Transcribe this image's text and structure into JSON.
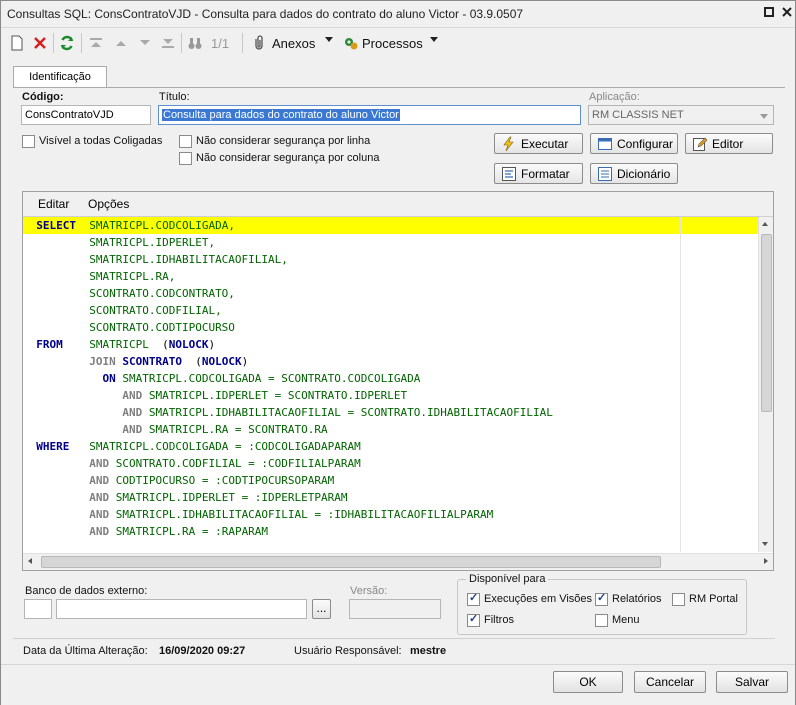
{
  "window": {
    "title": "Consultas SQL: ConsContratoVJD - Consulta para dados do contrato do aluno Victor - 03.9.0507"
  },
  "toolbar": {
    "page_indicator": "1/1",
    "anexos_label": "Anexos",
    "processos_label": "Processos"
  },
  "tabs": [
    {
      "label": "Identificação"
    }
  ],
  "form": {
    "codigo_label": "Código:",
    "codigo_value": "ConsContratoVJD",
    "titulo_label": "Título:",
    "titulo_value": "Consulta para dados do contrato do aluno Victor",
    "aplicacao_label": "Aplicação:",
    "aplicacao_value": "RM CLASSIS NET",
    "visivel_label": "Visível a todas Coligadas",
    "seg_linha_label": "Não considerar segurança por linha",
    "seg_coluna_label": "Não considerar segurança por coluna"
  },
  "buttons": {
    "executar": "Executar",
    "configurar": "Configurar",
    "editor": "Editor",
    "formatar": "Formatar",
    "dicionario": "Dicionário"
  },
  "editor_menu": {
    "editar": "Editar",
    "opcoes": "Opções"
  },
  "sql_lines": [
    [
      [
        "kw",
        "SELECT"
      ],
      [
        "t",
        "  "
      ],
      [
        "id",
        "SMATRICPL.CODCOLIGADA,"
      ]
    ],
    [
      [
        "t",
        "        "
      ],
      [
        "id",
        "SMATRICPL.IDPERLET,"
      ]
    ],
    [
      [
        "t",
        "        "
      ],
      [
        "id",
        "SMATRICPL.IDHABILITACAOFILIAL,"
      ]
    ],
    [
      [
        "t",
        "        "
      ],
      [
        "id",
        "SMATRICPL.RA,"
      ]
    ],
    [
      [
        "t",
        "        "
      ],
      [
        "id",
        "SCONTRATO.CODCONTRATO,"
      ]
    ],
    [
      [
        "t",
        "        "
      ],
      [
        "id",
        "SCONTRATO.CODFILIAL,"
      ]
    ],
    [
      [
        "t",
        "        "
      ],
      [
        "id",
        "SCONTRATO.CODTIPOCURSO"
      ]
    ],
    [
      [
        "kw",
        "FROM"
      ],
      [
        "t",
        "    "
      ],
      [
        "id",
        "SMATRICPL"
      ],
      [
        "t",
        "  ("
      ],
      [
        "kw",
        "NOLOCK"
      ],
      [
        "t",
        ")"
      ]
    ],
    [
      [
        "t",
        "        "
      ],
      [
        "kw2",
        "JOIN"
      ],
      [
        "t",
        " "
      ],
      [
        "kw",
        "SCONTRATO"
      ],
      [
        "t",
        "  ("
      ],
      [
        "kw",
        "NOLOCK"
      ],
      [
        "t",
        ")"
      ]
    ],
    [
      [
        "t",
        "          "
      ],
      [
        "kw",
        "ON"
      ],
      [
        "t",
        " "
      ],
      [
        "id",
        "SMATRICPL.CODCOLIGADA = SCONTRATO.CODCOLIGADA"
      ]
    ],
    [
      [
        "t",
        "             "
      ],
      [
        "kw2",
        "AND"
      ],
      [
        "t",
        " "
      ],
      [
        "id",
        "SMATRICPL.IDPERLET = SCONTRATO.IDPERLET"
      ]
    ],
    [
      [
        "t",
        "             "
      ],
      [
        "kw2",
        "AND"
      ],
      [
        "t",
        " "
      ],
      [
        "id",
        "SMATRICPL.IDHABILITACAOFILIAL = SCONTRATO.IDHABILITACAOFILIAL"
      ]
    ],
    [
      [
        "t",
        "             "
      ],
      [
        "kw2",
        "AND"
      ],
      [
        "t",
        " "
      ],
      [
        "id",
        "SMATRICPL.RA = SCONTRATO.RA"
      ]
    ],
    [
      [
        "kw",
        "WHERE"
      ],
      [
        "t",
        "   "
      ],
      [
        "id",
        "SMATRICPL.CODCOLIGADA = :CODCOLIGADAPARAM"
      ]
    ],
    [
      [
        "t",
        "        "
      ],
      [
        "kw2",
        "AND"
      ],
      [
        "t",
        " "
      ],
      [
        "id",
        "SCONTRATO.CODFILIAL = :CODFILIALPARAM"
      ]
    ],
    [
      [
        "t",
        "        "
      ],
      [
        "kw2",
        "AND"
      ],
      [
        "t",
        " "
      ],
      [
        "id",
        "CODTIPOCURSO = :CODTIPOCURSOPARAM"
      ]
    ],
    [
      [
        "t",
        "        "
      ],
      [
        "kw2",
        "AND"
      ],
      [
        "t",
        " "
      ],
      [
        "id",
        "SMATRICPL.IDPERLET = :IDPERLETPARAM"
      ]
    ],
    [
      [
        "t",
        "        "
      ],
      [
        "kw2",
        "AND"
      ],
      [
        "t",
        " "
      ],
      [
        "id",
        "SMATRICPL.IDHABILITACAOFILIAL = :IDHABILITACAOFILIALPARAM"
      ]
    ],
    [
      [
        "t",
        "        "
      ],
      [
        "kw2",
        "AND"
      ],
      [
        "t",
        " "
      ],
      [
        "id",
        "SMATRICPL.RA = :RAPARAM"
      ]
    ]
  ],
  "banco": {
    "label": "Banco de dados externo:",
    "browse": "...",
    "versao_label": "Versão:"
  },
  "disponivel": {
    "title": "Disponível para",
    "exec_visoes": "Execuções em Visões",
    "relatorios": "Relatórios",
    "rm_portal": "RM Portal",
    "filtros": "Filtros",
    "menu": "Menu"
  },
  "status": {
    "data_label": "Data da Última Alteração:",
    "data_value": "16/09/2020 09:27",
    "usuario_label": "Usuário Responsável:",
    "usuario_value": "mestre"
  },
  "dialog": {
    "ok": "OK",
    "cancelar": "Cancelar",
    "salvar": "Salvar"
  }
}
